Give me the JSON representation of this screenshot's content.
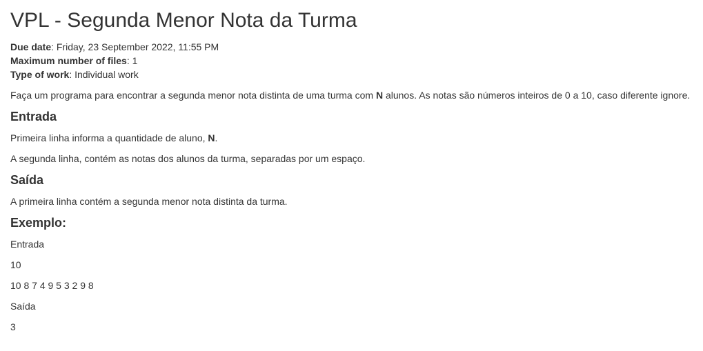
{
  "title": "VPL - Segunda Menor Nota da Turma",
  "meta": {
    "due_label": "Due date",
    "due_value": ": Friday, 23 September 2022, 11:55 PM",
    "files_label": "Maximum number of files",
    "files_value": ": 1",
    "work_label": "Type of work",
    "work_value": ": Individual work"
  },
  "description": {
    "before_bold": "Faça um programa para encontrar a segunda menor nota distinta de uma turma com ",
    "bold": "N",
    "after_bold": " alunos. As notas são números inteiros de 0 a 10, caso diferente ignore."
  },
  "entrada": {
    "heading": "Entrada",
    "line1_before": "Primeira linha informa a quantidade de aluno, ",
    "line1_bold": "N",
    "line1_after": ".",
    "line2": "A segunda linha, contém as notas dos alunos da turma, separadas por um espaço."
  },
  "saida": {
    "heading": "Saída",
    "line1": "A primeira linha contém a segunda menor nota distinta da turma."
  },
  "exemplo": {
    "heading": "Exemplo:",
    "lines": [
      "Entrada",
      "10",
      "10 8 7 4 9 5 3 2 9 8",
      "Saída",
      "3"
    ]
  }
}
